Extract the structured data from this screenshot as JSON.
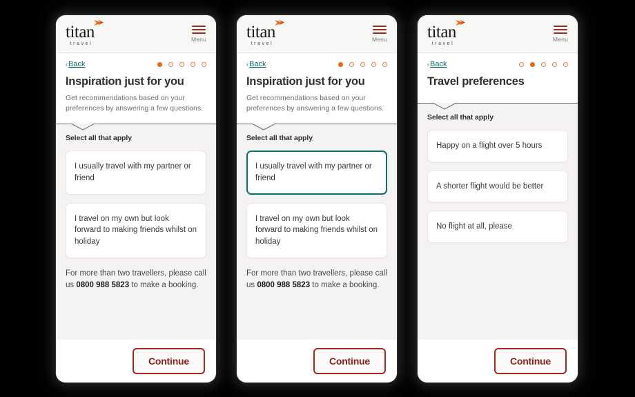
{
  "brand": {
    "logo_word": "titan",
    "logo_sub": "travel",
    "accent_orange": "#ec6608",
    "accent_teal": "#0e6e6e",
    "accent_red": "#a5281f"
  },
  "header": {
    "menu_label": "Menu",
    "menu_icon": "hamburger-icon",
    "logo_icon": "titan-travel-logo"
  },
  "panels": [
    {
      "back_label": "Back",
      "back_chevron": "‹",
      "progress_total": 5,
      "progress_active": 1,
      "title": "Inspiration just for you",
      "subtitle": "Get recommendations based on your preferences by answering a few questions.",
      "question_label": "Select all that apply",
      "options": [
        {
          "text": "I usually travel with my partner or friend",
          "selected": false
        },
        {
          "text": "I travel on my own but look forward to making friends whilst on holiday",
          "selected": false
        }
      ],
      "note_before": "For more than two travellers, please call us ",
      "note_phone": "0800 988 5823",
      "note_after": " to make a booking.",
      "continue_label": "Continue"
    },
    {
      "back_label": "Back",
      "back_chevron": "‹",
      "progress_total": 5,
      "progress_active": 1,
      "title": "Inspiration just for you",
      "subtitle": "Get recommendations based on your preferences by answering a few questions.",
      "question_label": "Select all that apply",
      "options": [
        {
          "text": "I usually travel with my partner or friend",
          "selected": true
        },
        {
          "text": "I travel on my own but look forward to making friends whilst on holiday",
          "selected": false
        }
      ],
      "note_before": "For more than two travellers, please call us ",
      "note_phone": "0800 988 5823",
      "note_after": " to make a booking.",
      "continue_label": "Continue"
    },
    {
      "back_label": "Back",
      "back_chevron": "‹",
      "progress_total": 5,
      "progress_active": 2,
      "title": "Travel preferences",
      "subtitle": "",
      "question_label": "Select all that apply",
      "options": [
        {
          "text": "Happy on a flight over 5 hours",
          "selected": false
        },
        {
          "text": "A shorter flight would be better",
          "selected": false
        },
        {
          "text": "No flight at all, please",
          "selected": false
        }
      ],
      "note_before": "",
      "note_phone": "",
      "note_after": "",
      "continue_label": "Continue"
    }
  ]
}
